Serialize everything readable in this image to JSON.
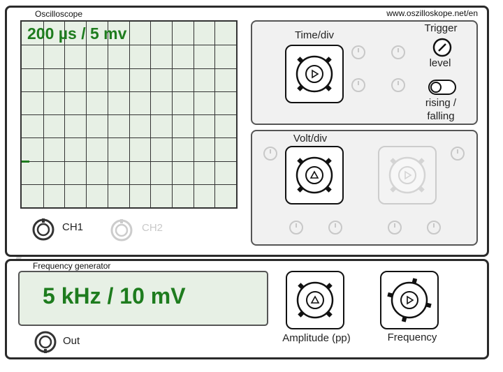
{
  "oscilloscope": {
    "title": "Oscilloscope",
    "url": "www.oszilloskope.net/en",
    "screen_readout": "200 µs / 5 mv",
    "ch1_label": "CH1",
    "ch2_label": "CH2"
  },
  "timebase": {
    "time_div_label": "Time/div",
    "trigger_label": "Trigger",
    "level_label": "level",
    "edge_label": "rising / falling",
    "knob_icon": "play-right-icon"
  },
  "vertical": {
    "volt_div_label": "Volt/div",
    "knob_icon": "play-up-icon"
  },
  "generator": {
    "title": "Frequency generator",
    "display": "5 kHz / 10 mV",
    "out_label": "Out",
    "amplitude_label": "Amplitude (pp)",
    "frequency_label": "Frequency"
  },
  "colors": {
    "screen_bg": "#e7f0e5",
    "readout_text": "#1e7c1e",
    "trace": "#1e7c1e"
  }
}
